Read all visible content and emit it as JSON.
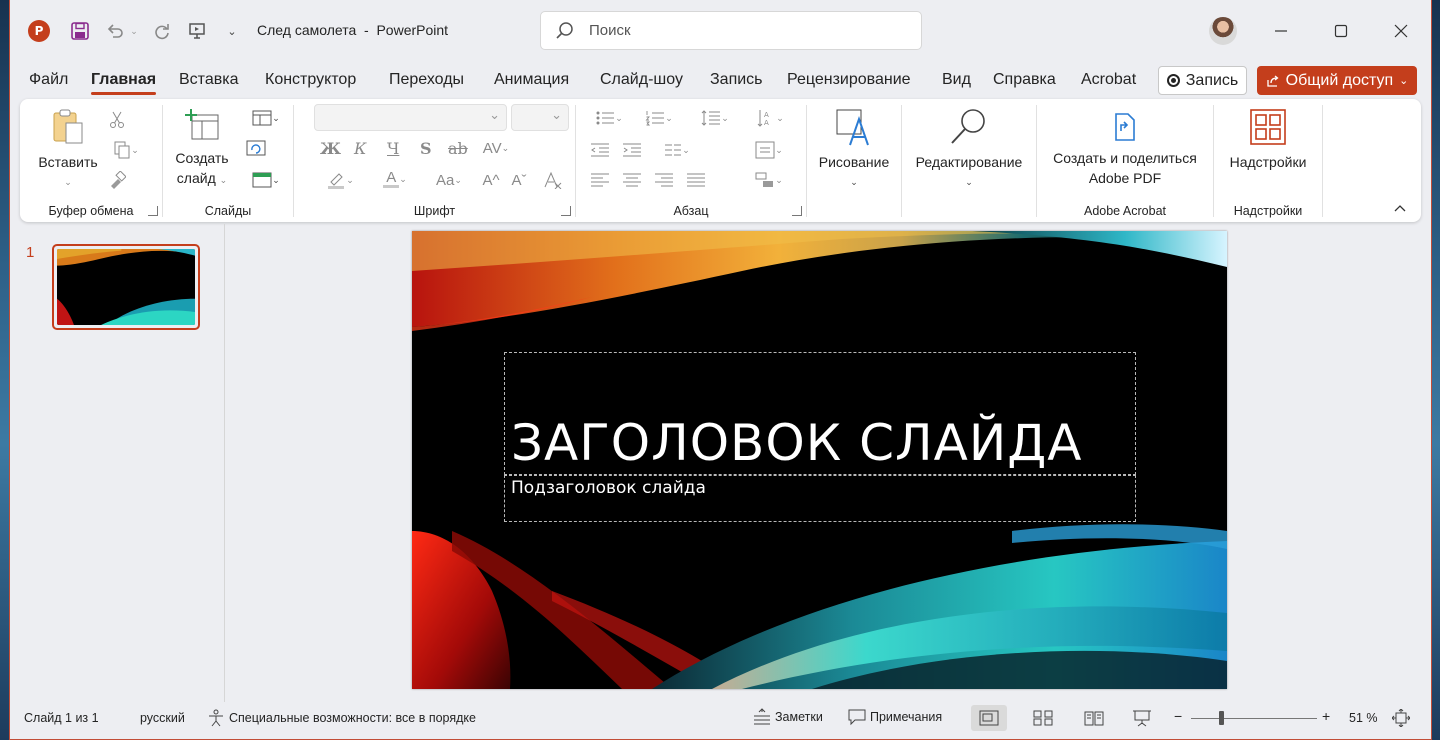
{
  "app": {
    "document_title": "След самолета  -  PowerPoint",
    "search_placeholder": "Поиск",
    "accent_color": "#c43e1c"
  },
  "menu": {
    "tabs": [
      "Файл",
      "Главная",
      "Вставка",
      "Конструктор",
      "Переходы",
      "Анимация",
      "Слайд-шоу",
      "Запись",
      "Рецензирование",
      "Вид",
      "Справка",
      "Acrobat"
    ],
    "active_tab": "Главная",
    "record_label": "Запись",
    "share_label": "Общий доступ"
  },
  "ribbon": {
    "clipboard": {
      "paste_label": "Вставить",
      "group_label": "Буфер обмена"
    },
    "slides": {
      "new_slide_line1": "Создать",
      "new_slide_line2": "слайд",
      "group_label": "Слайды"
    },
    "font": {
      "group_label": "Шрифт",
      "bold": "Ж",
      "italic": "К",
      "underline": "Ч",
      "shadow": "S",
      "strike": "ab",
      "font_color_letter": "A",
      "change_case": "Aa"
    },
    "paragraph": {
      "group_label": "Абзац"
    },
    "drawing": {
      "label": "Рисование"
    },
    "editing": {
      "label": "Редактирование"
    },
    "adobe": {
      "label_line1": "Создать и поделиться",
      "label_line2": "Adobe PDF",
      "group_label": "Adobe Acrobat"
    },
    "addins": {
      "label": "Надстройки",
      "group_label": "Надстройки"
    }
  },
  "thumbnails": {
    "number": "1"
  },
  "slide": {
    "title": "ЗАГОЛОВОК СЛАЙДА",
    "subtitle": "Подзаголовок слайда"
  },
  "status": {
    "slide_counter": "Слайд 1 из 1",
    "language": "русский",
    "accessibility": "Специальные возможности: все в порядке",
    "notes": "Заметки",
    "comments": "Примечания",
    "zoom": "51 %",
    "zoom_fraction": 0.24
  }
}
